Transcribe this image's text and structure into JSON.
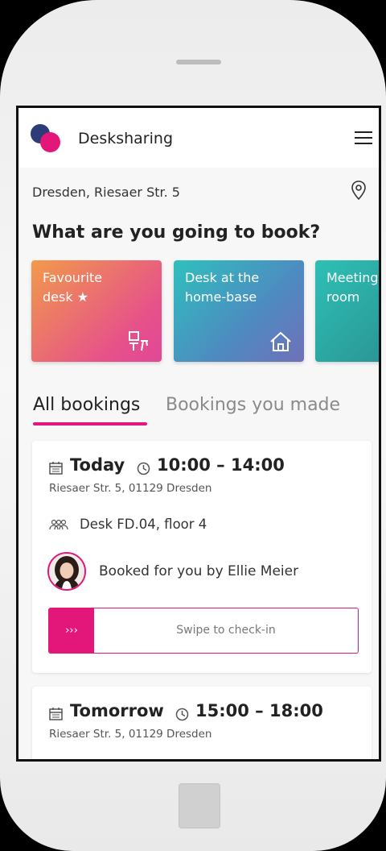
{
  "app": {
    "title": "Desksharing"
  },
  "location": {
    "text": "Dresden, Riesaer Str. 5"
  },
  "question": "What are you going to book?",
  "tiles": [
    {
      "line1": "Favourite",
      "line2": "desk ★",
      "icon": "desk-icon"
    },
    {
      "line1": "Desk at the",
      "line2": "home-base",
      "icon": "home-icon"
    },
    {
      "line1": "Meeting",
      "line2": "room",
      "icon": ""
    }
  ],
  "tabs": {
    "all": "All bookings",
    "made": "Bookings you made"
  },
  "bookings": [
    {
      "day": "Today",
      "time": "10:00 – 14:00",
      "address": "Riesaer Str. 5, 01129 Dresden",
      "desk": "Desk FD.04, floor 4",
      "booked_by": "Booked for you by Ellie Meier",
      "swipe_handle": "›››",
      "swipe_label": "Swipe to check-in"
    },
    {
      "day": "Tomorrow",
      "time": "15:00 – 18:00",
      "address": "Riesaer Str. 5, 01129 Dresden"
    }
  ],
  "colors": {
    "accent": "#e3177a",
    "brand_blue": "#2d3b76"
  }
}
